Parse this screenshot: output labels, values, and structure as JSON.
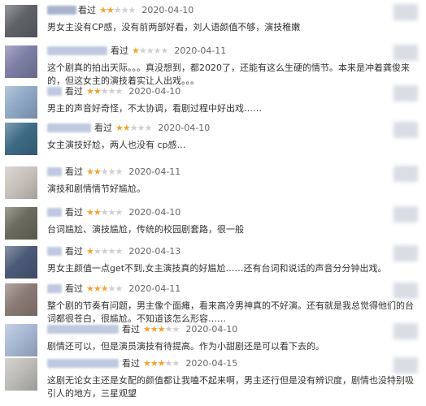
{
  "reviews": [
    {
      "seen": "看过",
      "rating": 2,
      "date": "2020-04-10",
      "comment": "男女主没有CP感，没有前两部好看，刘人语颜值不够，演技稚嫩",
      "avatar_color": "#5f6368"
    },
    {
      "seen": "看过",
      "rating": 1,
      "date": "2020-04-11",
      "comment": "这个剧真的拍出天际。。。真没想到，都2020了，还能有这么生硬的情节。本来是冲着龚俊来的，但这女主的演技着实让人出戏。。。",
      "avatar_color": "#7d7fa6"
    },
    {
      "seen": "看过",
      "rating": 2,
      "date": "2020-04-10",
      "comment": "男主的声音好奇怪，不太协调，看剧过程中好出戏……",
      "avatar_color": "#8fa9c7"
    },
    {
      "seen": "看过",
      "rating": 2,
      "date": "2020-04-10",
      "comment": "女主演技好尬，两人也没有 cp感…",
      "avatar_color": "#3e6b86"
    },
    {
      "seen": "看过",
      "rating": 2,
      "date": "2020-04-11",
      "comment": "演技和剧情情节好尴尬。",
      "avatar_color": "#c9c2bc"
    },
    {
      "seen": "看过",
      "rating": 2,
      "date": "2020-04-10",
      "comment": "台词尴尬、演技尴尬，传统的校园剧套路，很一般",
      "avatar_color": "#6a6a5e"
    },
    {
      "seen": "看过",
      "rating": 1,
      "date": "2020-04-13",
      "comment": "男女主颜值一点get不到,女主演技真的好尴尬……还有台词和说话的声音分分钟出戏。",
      "avatar_color": "#4b5a78"
    },
    {
      "seen": "看过",
      "rating": 3,
      "date": "2020-04-11",
      "comment": "整个剧的节奏有问题，男主像个面瘫，看来高冷男神真的不好演。还有就是我总觉得他们的台词都很苍白，很尴尬。不知道该怎么形容……",
      "avatar_color": "#8c7b76"
    },
    {
      "seen": "看过",
      "rating": 3,
      "date": "2020-04-10",
      "comment": "剧情还可以，但是演员演技有待提高。作为小甜剧还是可以看下去的。",
      "avatar_color": "#a8b8d4"
    },
    {
      "seen": "看过",
      "rating": 3,
      "date": "2020-04-15",
      "comment": "这剧无论女主还是女配的颜值都让我嗑不起来啊，男主还行但是没有辨识度，剧情也没特别吸引人的地方，三星观望",
      "avatar_color": "#bdbcb8"
    }
  ]
}
